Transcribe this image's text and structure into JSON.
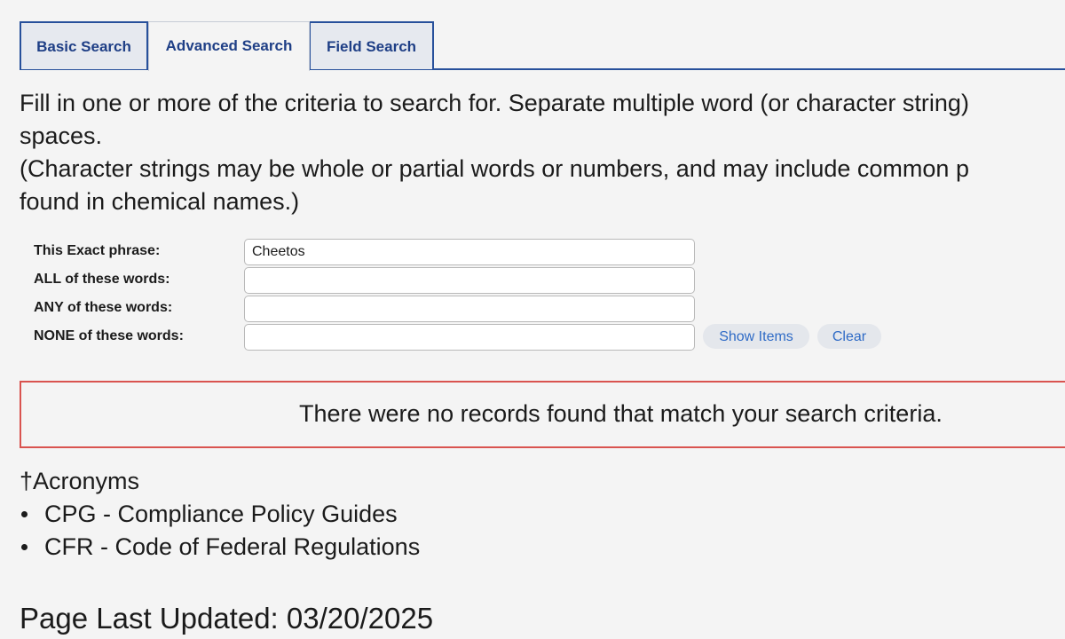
{
  "tabs": [
    {
      "label": "Basic Search",
      "active": false
    },
    {
      "label": "Advanced Search",
      "active": true
    },
    {
      "label": "Field Search",
      "active": false
    }
  ],
  "instructions": {
    "line1": "Fill in one or more of the criteria to search for. Separate multiple word (or character string)",
    "line2": "spaces.",
    "line3": "(Character strings may be whole or partial words or numbers, and may include common p",
    "line4": "found in chemical names.)"
  },
  "form": {
    "exact_phrase": {
      "label": "This Exact phrase:",
      "value": "Cheetos"
    },
    "all_words": {
      "label": "ALL of these words:",
      "value": ""
    },
    "any_words": {
      "label": "ANY of these words:",
      "value": ""
    },
    "none_words": {
      "label": "NONE of these words:",
      "value": ""
    },
    "show_items_label": "Show Items",
    "clear_label": "Clear"
  },
  "result_message": "There were no records found that match your search criteria.",
  "acronyms": {
    "heading": "†Acronyms",
    "items": [
      "CPG - Compliance Policy Guides",
      "CFR - Code of Federal Regulations"
    ]
  },
  "last_updated": "Page Last Updated: 03/20/2025",
  "colors": {
    "tab_border": "#27509b",
    "tab_text": "#1f3f86",
    "button_text": "#2f6bc6",
    "error_border": "#d9534f"
  }
}
